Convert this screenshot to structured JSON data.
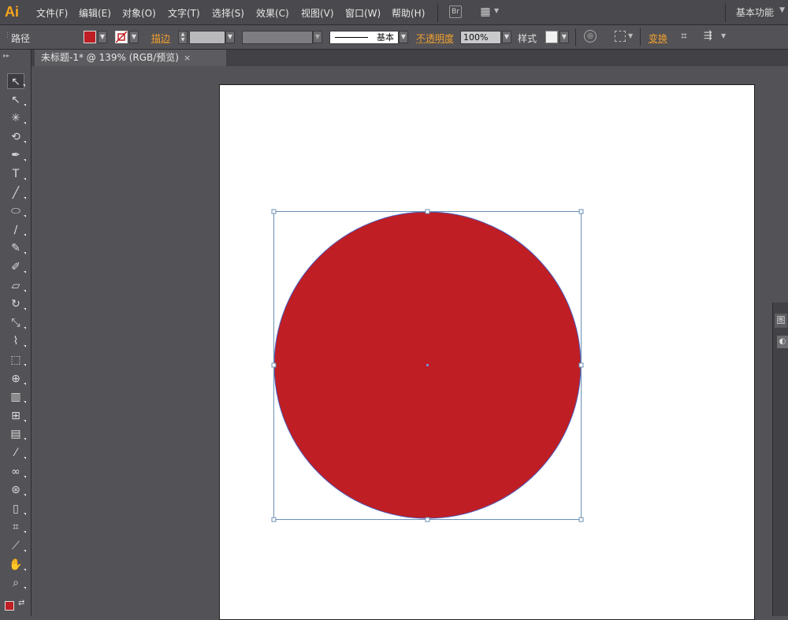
{
  "app": {
    "logo": "Ai",
    "workspace": "基本功能"
  },
  "menu": [
    "文件(F)",
    "编辑(E)",
    "对象(O)",
    "文字(T)",
    "选择(S)",
    "效果(C)",
    "视图(V)",
    "窗口(W)",
    "帮助(H)"
  ],
  "menubar_icons": {
    "bridge": "Br",
    "arrange": "▦"
  },
  "control": {
    "selection_label": "路径",
    "stroke_label": "描边",
    "stroke_profile": "基本",
    "opacity_label": "不透明度",
    "opacity_value": "100%",
    "style_label": "样式",
    "transform_label": "变换",
    "fill_color": "#be1e24"
  },
  "document_tab": {
    "title": "未标题-1* @ 139% (RGB/预览)",
    "close": "×"
  },
  "tools": [
    {
      "name": "selection-tool-icon",
      "glyph": "↖"
    },
    {
      "name": "direct-selection-tool-icon",
      "glyph": "↖"
    },
    {
      "name": "magic-wand-tool-icon",
      "glyph": "✳"
    },
    {
      "name": "lasso-tool-icon",
      "glyph": "⟲"
    },
    {
      "name": "pen-tool-icon",
      "glyph": "✒"
    },
    {
      "name": "type-tool-icon",
      "glyph": "T"
    },
    {
      "name": "line-tool-icon",
      "glyph": "╱"
    },
    {
      "name": "ellipse-tool-icon",
      "glyph": "⬭"
    },
    {
      "name": "paintbrush-tool-icon",
      "glyph": "∕"
    },
    {
      "name": "pencil-tool-icon",
      "glyph": "✎"
    },
    {
      "name": "blob-brush-tool-icon",
      "glyph": "✐"
    },
    {
      "name": "eraser-tool-icon",
      "glyph": "▱"
    },
    {
      "name": "rotate-tool-icon",
      "glyph": "↻"
    },
    {
      "name": "scale-tool-icon",
      "glyph": "⤡"
    },
    {
      "name": "warp-tool-icon",
      "glyph": "⌇"
    },
    {
      "name": "free-transform-tool-icon",
      "glyph": "⬚"
    },
    {
      "name": "shape-builder-tool-icon",
      "glyph": "⊕"
    },
    {
      "name": "perspective-grid-tool-icon",
      "glyph": "▥"
    },
    {
      "name": "mesh-tool-icon",
      "glyph": "⊞"
    },
    {
      "name": "gradient-tool-icon",
      "glyph": "▤"
    },
    {
      "name": "eyedropper-tool-icon",
      "glyph": "⁄"
    },
    {
      "name": "blend-tool-icon",
      "glyph": "∞"
    },
    {
      "name": "symbol-sprayer-tool-icon",
      "glyph": "⊛"
    },
    {
      "name": "column-graph-tool-icon",
      "glyph": "▯"
    },
    {
      "name": "artboard-tool-icon",
      "glyph": "⌗"
    },
    {
      "name": "slice-tool-icon",
      "glyph": "⟋"
    },
    {
      "name": "hand-tool-icon",
      "glyph": "✋"
    },
    {
      "name": "zoom-tool-icon",
      "glyph": "⌕"
    }
  ],
  "panel": {
    "tab1": "图",
    "tab2": "◐"
  },
  "artwork": {
    "shape": "circle",
    "fill": "#be1e24",
    "selection_color": "#4f7fae"
  }
}
